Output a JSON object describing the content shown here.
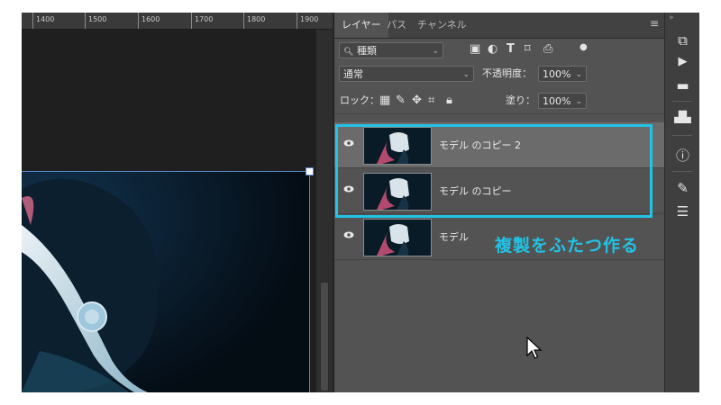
{
  "ruler": {
    "labels": [
      "1400",
      "1500",
      "1600",
      "1700",
      "1800",
      "1900"
    ]
  },
  "panel": {
    "tabs": [
      {
        "label": "レイヤー",
        "active": true
      },
      {
        "label": "パス",
        "active": false
      },
      {
        "label": "チャンネル",
        "active": false
      }
    ],
    "menu_icon": "hamburger-icon",
    "filter": {
      "value": "種類",
      "icon": "search-icon"
    },
    "blend_mode": "通常",
    "opacity": {
      "label": "不透明度：",
      "value": "100%"
    },
    "lock": {
      "label": "ロック："
    },
    "fill": {
      "label": "塗り：",
      "value": "100%"
    },
    "layers": [
      {
        "name": "モデル のコピー 2",
        "selected": true,
        "visible": true
      },
      {
        "name": "モデル のコピー",
        "selected": false,
        "visible": true
      },
      {
        "name": "モデル",
        "selected": false,
        "visible": true
      }
    ]
  },
  "annotation": {
    "text": "複製をふたつ作る",
    "color": "#22c3e6"
  },
  "toolbar": {
    "icons": [
      "libraries-icon",
      "play-icon",
      "comment-icon",
      "histogram-icon",
      "info-icon",
      "brush-settings-icon",
      "adjust-icon"
    ]
  },
  "colors": {
    "highlight": "#22c3e6",
    "selection": "#5b87c9"
  }
}
